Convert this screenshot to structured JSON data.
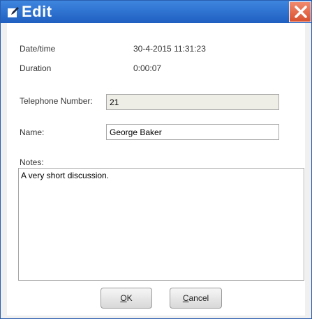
{
  "window": {
    "title": "Edit"
  },
  "fields": {
    "datetime_label": "Date/time",
    "datetime_value": "30-4-2015 11:31:23",
    "duration_label": "Duration",
    "duration_value": "0:00:07",
    "phone_label": "Telephone Number:",
    "phone_value": "21",
    "name_label": "Name:",
    "name_value": "George Baker",
    "notes_label": "Notes:",
    "notes_value": "A very short discussion."
  },
  "buttons": {
    "ok_mnemonic": "O",
    "ok_rest": "K",
    "cancel_mnemonic": "C",
    "cancel_rest": "ancel"
  },
  "icons": {
    "title": "edit-pencil-icon",
    "close": "close-x-icon"
  },
  "colors": {
    "titlebar": "#2f74d0",
    "close": "#e0603c",
    "readonly_field": "#eeede6"
  }
}
